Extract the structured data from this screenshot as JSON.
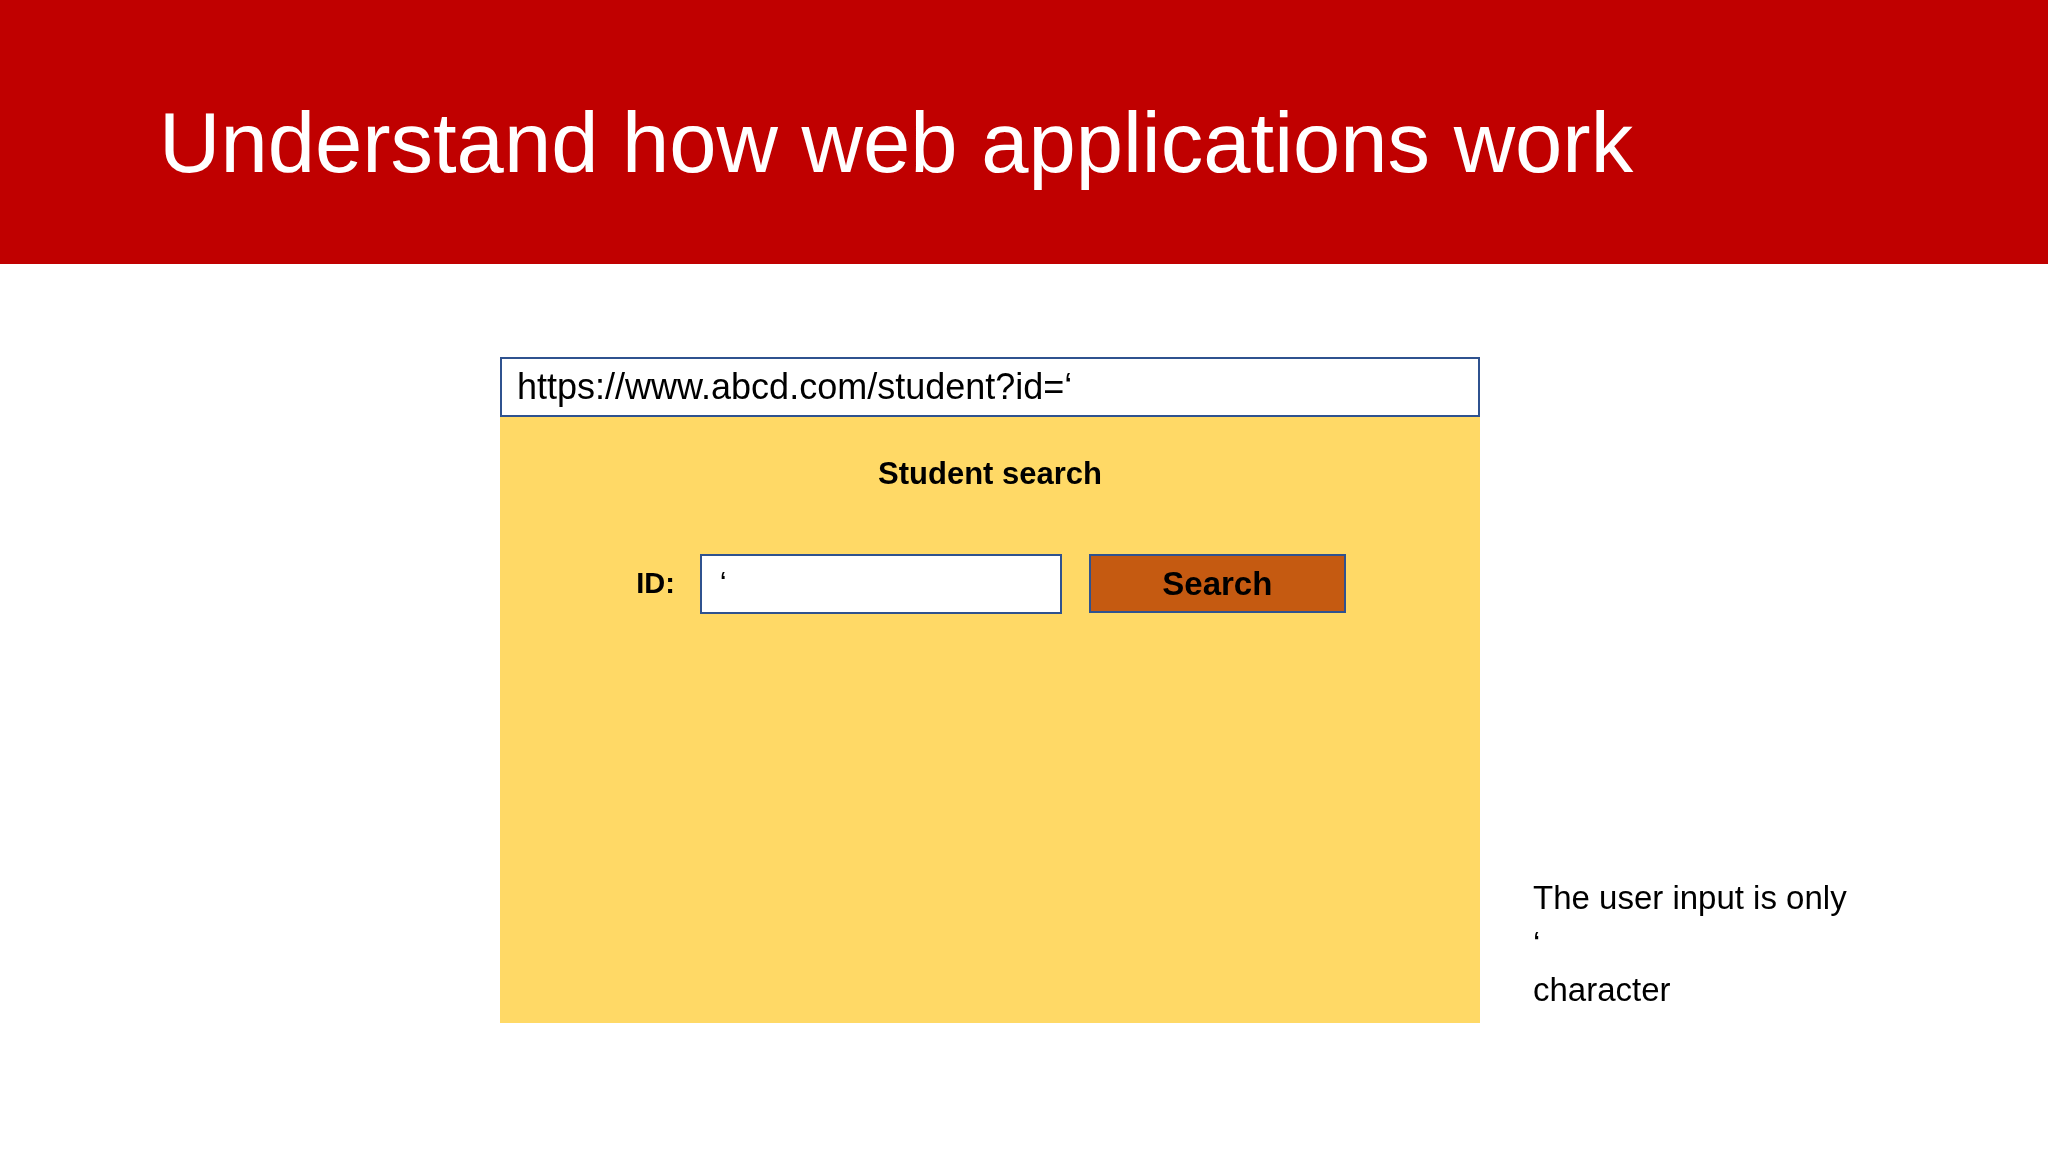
{
  "slide": {
    "title": "Understand how web applications work"
  },
  "browser": {
    "address_bar": {
      "value": "https://www.abcd.com/student?id=‘"
    },
    "page": {
      "heading": "Student search",
      "id_field": {
        "label": "ID:",
        "value": "‘"
      },
      "buttons": [
        "Search"
      ]
    }
  },
  "note": {
    "lines": [
      "The user input is only",
      "‘",
      "character"
    ]
  }
}
